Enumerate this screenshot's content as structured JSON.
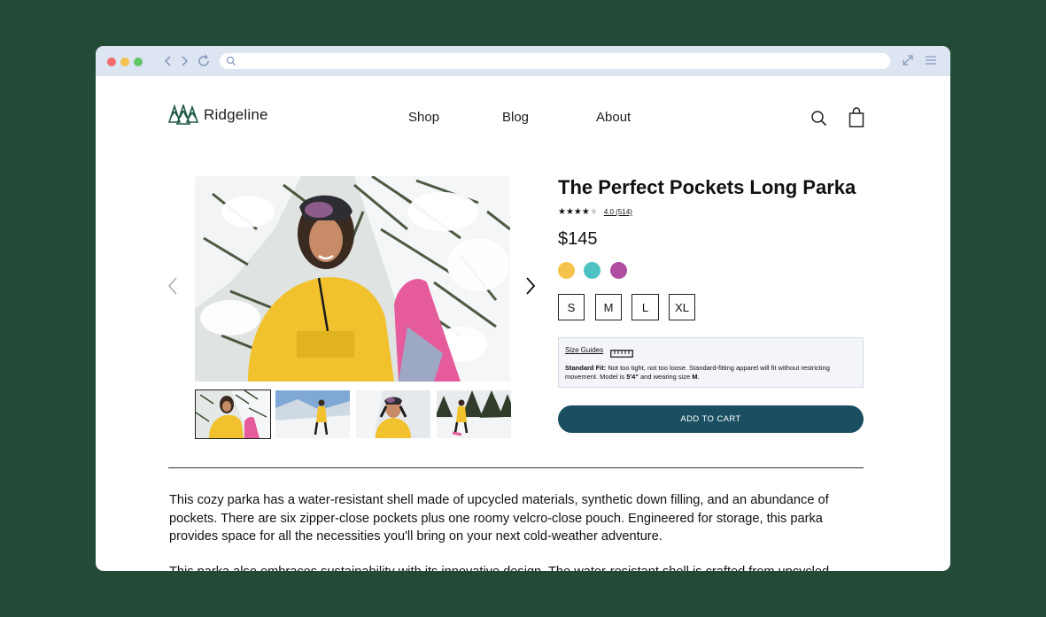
{
  "brand": {
    "name": "Ridgeline"
  },
  "nav": {
    "items": [
      "Shop",
      "Blog",
      "About"
    ]
  },
  "product": {
    "title": "The Perfect Pockets Long Parka",
    "rating": 4.0,
    "rating_text": "4.0 (514)",
    "price": "$145",
    "colors": [
      "#f6c34a",
      "#4ec2c3",
      "#b04fa1"
    ],
    "sizes": [
      "S",
      "M",
      "L",
      "XL"
    ],
    "size_guide": {
      "link": "Size Guides",
      "fit_label": "Standard Fit:",
      "fit_text": " Not too tight, not too loose. Standard-fitting apparel will fit without restricting movement. Model is ",
      "model_height": "5'4\"",
      "fit_text_2": " and wearing size ",
      "model_size": "M",
      "fit_end": "."
    },
    "add_to_cart": "ADD TO CART",
    "description_1": "This cozy parka has a water-resistant shell made of upcycled materials, synthetic down filling, and an abundance of pockets. There are six zipper-close pockets plus one roomy velcro-close pouch. Engineered for storage, this parka provides space for all the necessities you'll bring on your next cold-weather adventure.",
    "description_2": "This parka also embraces sustainability with its innovative design. The water-resistant shell is crafted from upcycled"
  },
  "icons": {
    "logo": "pine-trees-icon",
    "search": "search-icon",
    "cart": "shopping-bag-icon",
    "prev": "chevron-left-icon",
    "next": "chevron-right-icon",
    "ruler": "ruler-icon"
  },
  "colors": {
    "background": "#234a36",
    "accent": "#1a4f62",
    "chrome": "#dde5f2"
  }
}
